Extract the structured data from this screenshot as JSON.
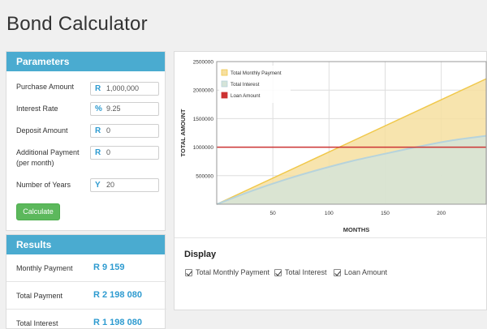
{
  "page": {
    "title": "Bond Calculator"
  },
  "parameters": {
    "heading": "Parameters",
    "fields": [
      {
        "label": "Purchase Amount",
        "prefix": "R",
        "value": "1,000,000"
      },
      {
        "label": "Interest Rate",
        "prefix": "%",
        "value": "9.25"
      },
      {
        "label": "Deposit Amount",
        "prefix": "R",
        "value": "0"
      },
      {
        "label": "Additional Payment",
        "label2": "(per month)",
        "prefix": "R",
        "value": "0"
      },
      {
        "label": "Number of Years",
        "prefix": "Y",
        "value": "20"
      }
    ],
    "calculate_label": "Calculate"
  },
  "results": {
    "heading": "Results",
    "rows": [
      {
        "label": "Monthly Payment",
        "value": "R 9 159"
      },
      {
        "label": "Total Payment",
        "value": "R 2 198 080"
      },
      {
        "label": "Total Interest",
        "value": "R 1 198 080"
      }
    ]
  },
  "display": {
    "title": "Display",
    "options": [
      {
        "label": "Total Monthly Payment",
        "checked": true
      },
      {
        "label": "Total Interest",
        "checked": true
      },
      {
        "label": "Loan Amount",
        "checked": true
      }
    ]
  },
  "chart_data": {
    "type": "area",
    "xlabel": "MONTHS",
    "ylabel": "TOTAL AMOUNT",
    "xlim": [
      0,
      240
    ],
    "ylim": [
      0,
      2500000
    ],
    "x_ticks": [
      50,
      100,
      150,
      200
    ],
    "y_ticks": [
      0,
      500000,
      1000000,
      1500000,
      2000000,
      2500000
    ],
    "grid": true,
    "legend_position": "top-left",
    "series": [
      {
        "name": "Total Monthly Payment",
        "color": "#f0c84a",
        "fill": "#f6dfa0",
        "x": [
          0,
          240
        ],
        "y": [
          0,
          2198080
        ]
      },
      {
        "name": "Total Interest",
        "color": "#b6d3dc",
        "fill": "#d5e4d8",
        "x": [
          0,
          30,
          60,
          90,
          120,
          150,
          180,
          210,
          240
        ],
        "y": [
          0,
          225000,
          425000,
          600000,
          755000,
          885000,
          1010000,
          1120000,
          1198080
        ]
      },
      {
        "name": "Loan Amount",
        "color": "#cc3333",
        "x": [
          0,
          240
        ],
        "y": [
          1000000,
          1000000
        ]
      }
    ]
  }
}
